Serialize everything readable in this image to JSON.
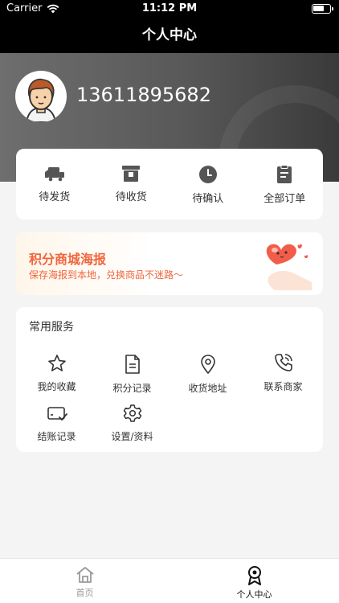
{
  "status_bar": {
    "carrier": "Carrier",
    "time": "11:12 PM"
  },
  "nav": {
    "title": "个人中心"
  },
  "profile": {
    "phone": "13611895682"
  },
  "orders": [
    {
      "label": "待发货",
      "icon": "truck-icon"
    },
    {
      "label": "待收货",
      "icon": "box-icon"
    },
    {
      "label": "待确认",
      "icon": "clock-icon"
    },
    {
      "label": "全部订单",
      "icon": "clipboard-icon"
    }
  ],
  "banner": {
    "title": "积分商城海报",
    "subtitle": "保存海报到本地，兑换商品不迷路～"
  },
  "services": {
    "title": "常用服务",
    "items": [
      {
        "label": "我的收藏",
        "icon": "star-icon"
      },
      {
        "label": "积分记录",
        "icon": "document-icon"
      },
      {
        "label": "收货地址",
        "icon": "location-icon"
      },
      {
        "label": "联系商家",
        "icon": "phone-icon"
      },
      {
        "label": "结账记录",
        "icon": "payment-card-icon"
      },
      {
        "label": "设置/资料",
        "icon": "settings-icon"
      }
    ]
  },
  "tabbar": [
    {
      "label": "首页",
      "icon": "home-icon",
      "active": false
    },
    {
      "label": "个人中心",
      "icon": "profile-icon",
      "active": true
    }
  ],
  "colors": {
    "accent": "#f0663c",
    "dark": "#000000",
    "background": "#f4f4f4"
  }
}
